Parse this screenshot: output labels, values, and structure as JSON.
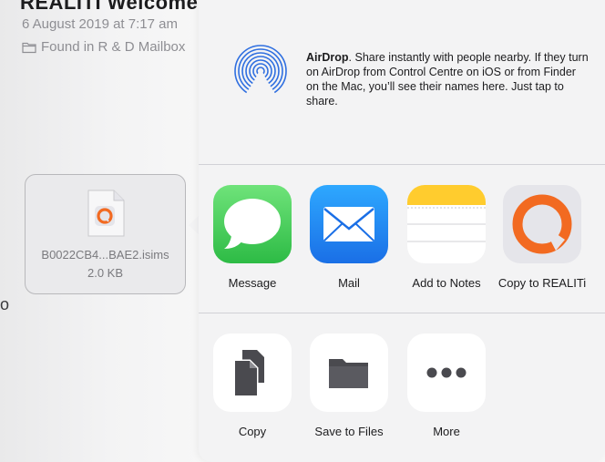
{
  "mail": {
    "header_partial": "REALITI Welcome Share Ticket!",
    "date": "6 August 2019 at 7:17 am",
    "folder": "Found in R & D Mailbox",
    "stray_char": "o"
  },
  "attachment": {
    "filename": "B0022CB4...BAE2.isims",
    "size": "2.0 KB"
  },
  "airdrop": {
    "title": "AirDrop",
    "description": ". Share instantly with people nearby. If they turn on AirDrop from Control Centre on iOS or from Finder on the Mac, you’ll see their names here. Just tap to share."
  },
  "share_apps": [
    {
      "label": "Message",
      "icon": "message-icon"
    },
    {
      "label": "Mail",
      "icon": "mail-icon"
    },
    {
      "label": "Add to Notes",
      "icon": "notes-icon"
    },
    {
      "label": "Copy to REALITi",
      "icon": "realiti-icon"
    }
  ],
  "actions": [
    {
      "label": "Copy",
      "icon": "copy-icon"
    },
    {
      "label": "Save to Files",
      "icon": "folder-icon"
    },
    {
      "label": "More",
      "icon": "more-icon"
    }
  ],
  "colors": {
    "message_green": "#34c759",
    "mail_blue": "#1a78f0",
    "notes_yellow": "#ffcc2e",
    "realiti_orange": "#f26a21",
    "airdrop_blue": "#2f6fe0"
  }
}
